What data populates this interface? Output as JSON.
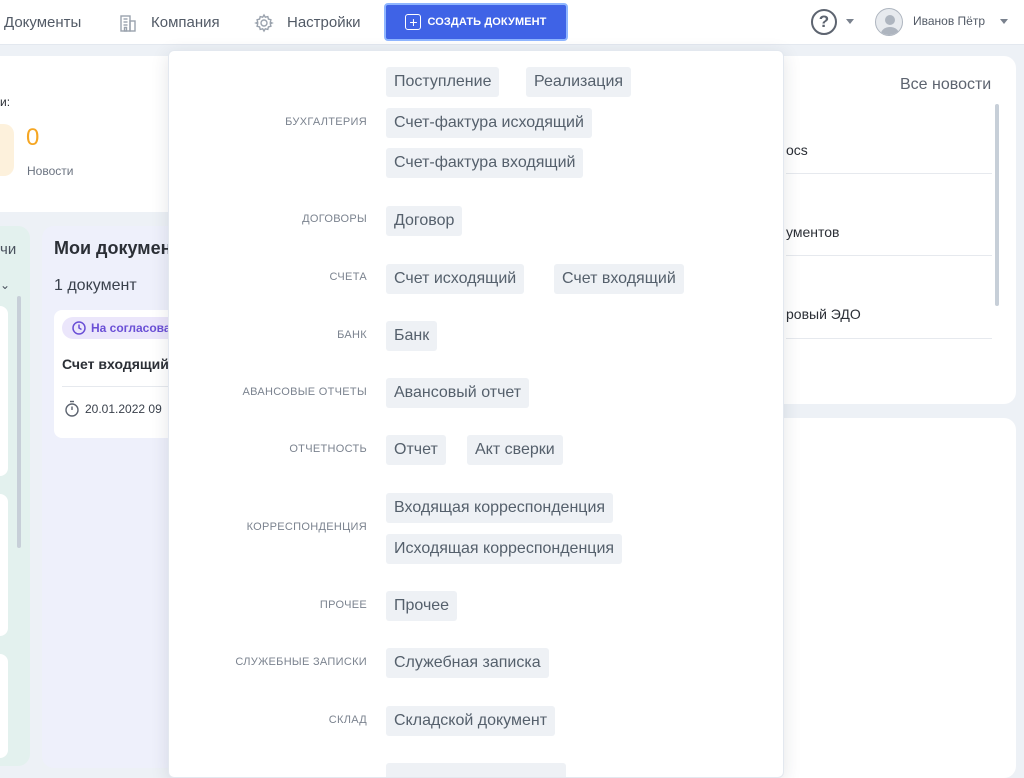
{
  "nav": {
    "documents": "Документы",
    "company": "Компания",
    "settings": "Настройки",
    "create_button": "СОЗДАТЬ ДОКУМЕНТ",
    "user_name": "Иванов Пётр",
    "help_glyph": "?"
  },
  "background": {
    "stats_label": "и:",
    "news_count": "0",
    "news_label": "Новости",
    "left_panel_label": "чи",
    "my_docs_title": "Мои докумен",
    "doc_count": "1 документ",
    "status_badge": "На согласова",
    "doc_title": "Счет входящий",
    "doc_date": "20.01.2022 09",
    "all_news": "Все новости",
    "news_items": [
      "ocs",
      "ументов",
      "ровый ЭДО"
    ]
  },
  "menu": {
    "categories": [
      {
        "label": "БУХГАЛТЕРИЯ",
        "items": [
          "Поступление",
          "Реализация",
          "Счет-фактура исходящий",
          "Счет-фактура входящий"
        ]
      },
      {
        "label": "ДОГОВОРЫ",
        "items": [
          "Договор"
        ]
      },
      {
        "label": "СЧЕТА",
        "items": [
          "Счет исходящий",
          "Счет входящий"
        ]
      },
      {
        "label": "БАНК",
        "items": [
          "Банк"
        ]
      },
      {
        "label": "АВАНСОВЫЕ ОТЧЕТЫ",
        "items": [
          "Авансовый отчет"
        ]
      },
      {
        "label": "ОТЧЕТНОСТЬ",
        "items": [
          "Отчет",
          "Акт сверки"
        ]
      },
      {
        "label": "КОРРЕСПОНДЕНЦИЯ",
        "items": [
          "Входящая корреспонденция",
          "Исходящая корреспонденция"
        ]
      },
      {
        "label": "ПРОЧЕЕ",
        "items": [
          "Прочее"
        ]
      },
      {
        "label": "СЛУЖЕБНЫЕ ЗАПИСКИ",
        "items": [
          "Служебная записка"
        ]
      },
      {
        "label": "СКЛАД",
        "items": [
          "Складской документ"
        ]
      }
    ]
  },
  "colors": {
    "primary": "#3f63e6",
    "accent_orange": "#f5a623",
    "status_purple": "#6a4fd6",
    "chip_bg": "#eef1f5"
  }
}
